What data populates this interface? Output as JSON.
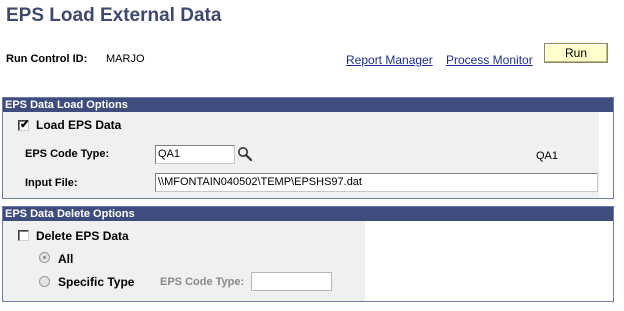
{
  "page": {
    "title": "EPS Load External Data"
  },
  "run_control": {
    "label": "Run Control ID:",
    "value": "MARJO"
  },
  "links": {
    "report_manager": "Report Manager",
    "process_monitor": "Process Monitor"
  },
  "buttons": {
    "run": "Run"
  },
  "load_options": {
    "header": "EPS Data Load Options",
    "load_checkbox_label": "Load EPS Data",
    "load_checked": true,
    "code_type_label": "EPS Code Type:",
    "code_type_value": "QA1",
    "code_type_description": "QA1",
    "input_file_label": "Input File:",
    "input_file_value": "\\\\MFONTAIN040502\\TEMP\\EPSHS97.dat"
  },
  "delete_options": {
    "header": "EPS Data Delete Options",
    "delete_checkbox_label": "Delete EPS Data",
    "delete_checked": false,
    "radio_all_label": "All",
    "radio_all_selected": true,
    "radio_specific_label": "Specific Type",
    "specific_code_type_label": "EPS Code Type:",
    "specific_code_type_value": ""
  },
  "icons": {
    "lookup": "magnifier-icon",
    "check": "checkmark-icon"
  },
  "colors": {
    "title": "#3f4a6b",
    "group_header_bg": "#3e4d7e",
    "link": "#1b2f8f",
    "run_button_bg": "#ffffcc"
  }
}
